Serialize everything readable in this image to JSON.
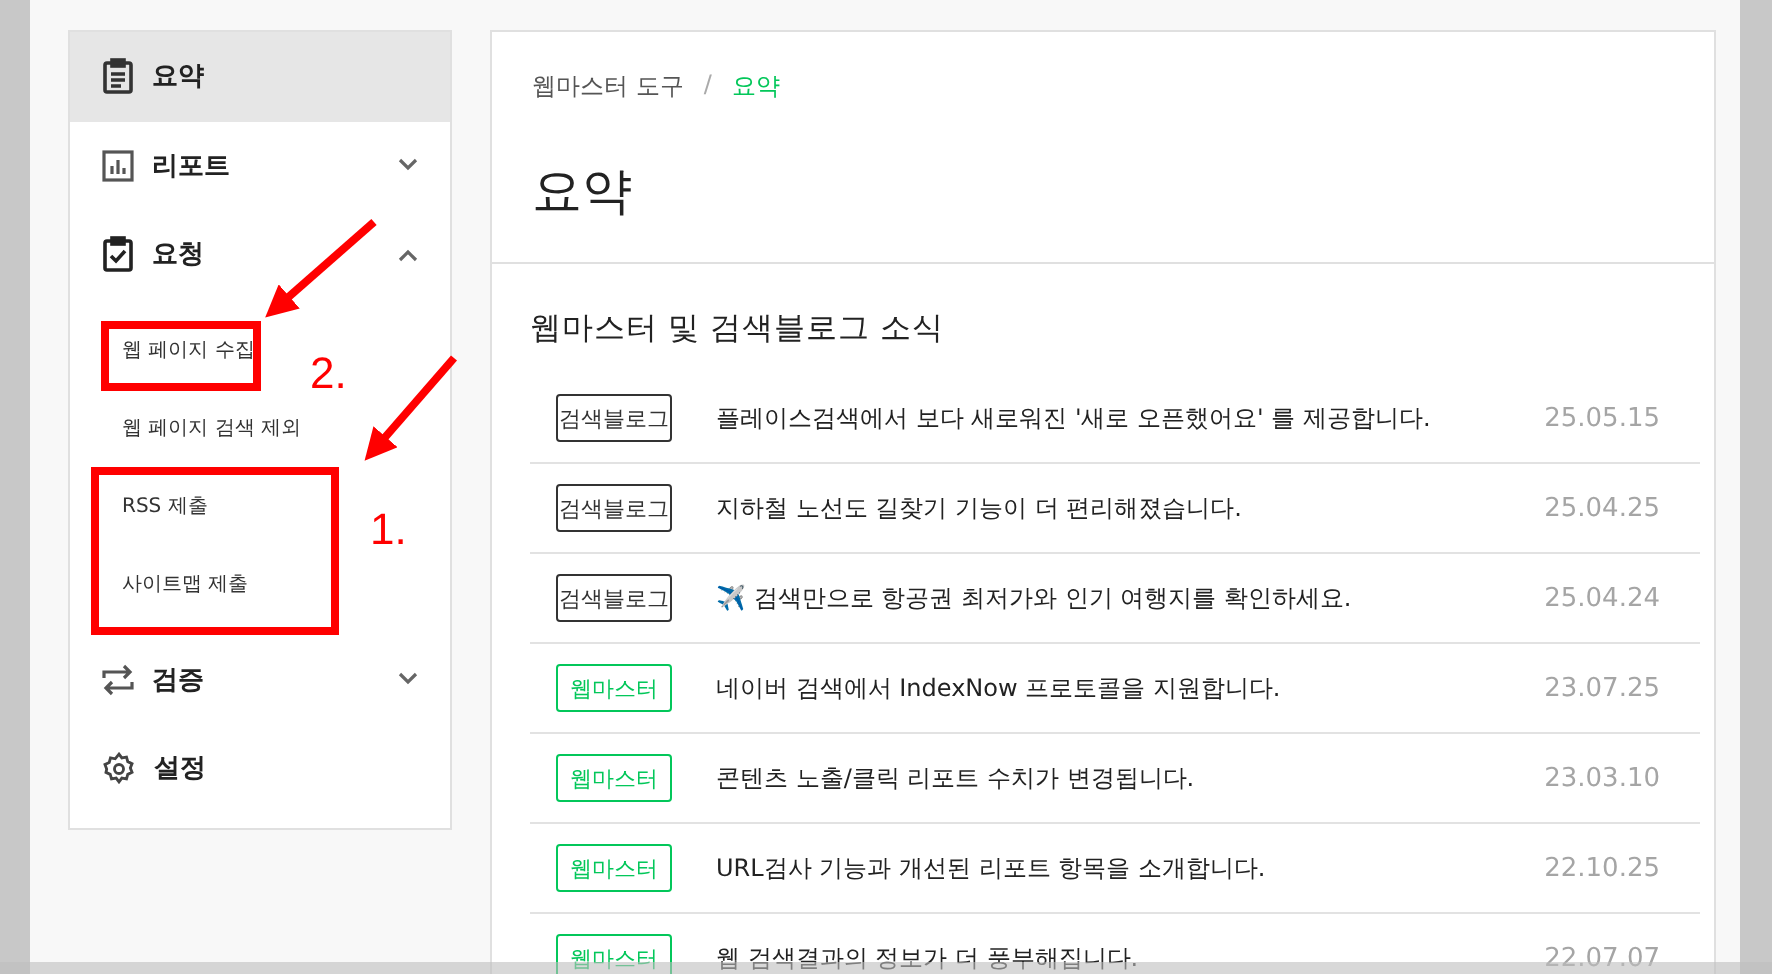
{
  "sidebar": {
    "items": [
      {
        "kind": "main",
        "label": "요약",
        "selected": true
      },
      {
        "kind": "main",
        "label": "리포트",
        "selected": false,
        "expanded": false
      },
      {
        "kind": "main",
        "label": "요청",
        "selected": false,
        "expanded": true
      },
      {
        "kind": "sub",
        "label": "웹 페이지 수집",
        "selected": false
      },
      {
        "kind": "sub",
        "label": "웹 페이지 검색 제외",
        "selected": false
      },
      {
        "kind": "sub",
        "label": "RSS 제출",
        "selected": false
      },
      {
        "kind": "sub",
        "label": "사이트맵 제출",
        "selected": false
      },
      {
        "kind": "main",
        "label": "검증",
        "selected": false,
        "expanded": false
      },
      {
        "kind": "main",
        "label": "설정",
        "selected": false
      }
    ]
  },
  "breadcrumb": {
    "separator": "/",
    "items": [
      {
        "label": "웹마스터 도구",
        "selected": false
      },
      {
        "label": "요약",
        "selected": true
      }
    ]
  },
  "title": "요약",
  "news": {
    "heading": "웹마스터 및 검색블로그 소식",
    "rows": [
      {
        "tag": "검색블로그",
        "kind": "blog",
        "title": "플레이스검색에서 보다 새로워진 '새로 오픈했어요' 를 제공합니다.",
        "date": "25.05.15"
      },
      {
        "tag": "검색블로그",
        "kind": "blog",
        "title": "지하철 노선도 길찾기 기능이 더 편리해졌습니다.",
        "date": "25.04.25"
      },
      {
        "tag": "검색블로그",
        "kind": "blog",
        "title": "✈️ 검색만으로 항공권 최저가와 인기 여행지를 확인하세요.",
        "date": "25.04.24"
      },
      {
        "tag": "웹마스터",
        "kind": "webmaster",
        "title": "네이버 검색에서 IndexNow 프로토콜을 지원합니다.",
        "date": "23.07.25"
      },
      {
        "tag": "웹마스터",
        "kind": "webmaster",
        "title": "콘텐츠 노출/클릭 리포트 수치가 변경됩니다.",
        "date": "23.03.10"
      },
      {
        "tag": "웹마스터",
        "kind": "webmaster",
        "title": "URL검사 기능과 개선된 리포트 항목을 소개합니다.",
        "date": "22.10.25"
      },
      {
        "tag": "웹마스터",
        "kind": "webmaster",
        "title": "웹 검색결과의 정보가 더 풍부해집니다.",
        "date": "22.07.07"
      }
    ]
  },
  "annotations": [
    {
      "label": "2."
    },
    {
      "label": "1."
    }
  ]
}
